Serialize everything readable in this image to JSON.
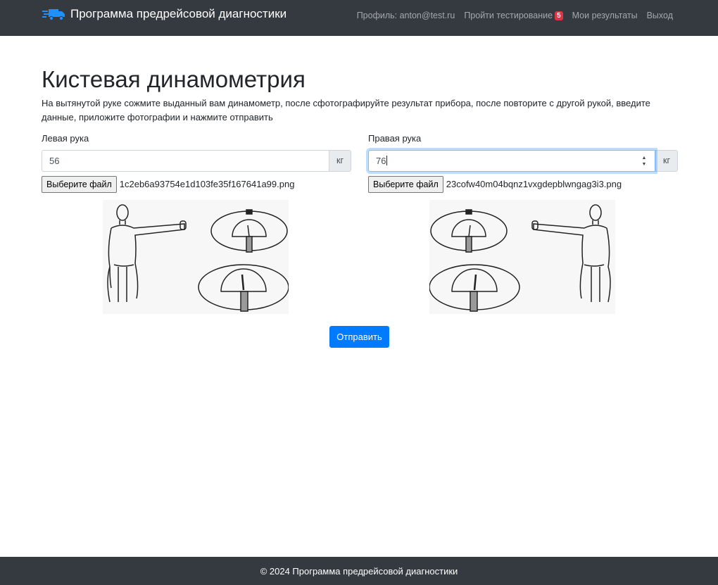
{
  "navbar": {
    "brand": "Программа предрейсовой диагностики",
    "brand_icon": "shipping-fast-truck-icon",
    "profile": "Профиль: anton@test.ru",
    "testing": "Пройти тестирование",
    "testing_badge": "5",
    "results": "Мои результаты",
    "logout": "Выход"
  },
  "page": {
    "title": "Кистевая динамометрия",
    "instructions": "На вытянутой руке сожмите выданный вам динамометр, после сфотографируйте результат прибора, после повторите с другой рукой, введите данные, приложите фотографии и нажмите отправить"
  },
  "left": {
    "label": "Левая рука",
    "value": "56",
    "unit": "кг",
    "file_button": "Выберите файл",
    "file_name": "1c2eb6a93754e1d103fe35f167641a99.png"
  },
  "right": {
    "label": "Правая рука",
    "value": "76",
    "unit": "кг",
    "file_button": "Выберите файл",
    "file_name": "23cofw40m04bqnz1vxgdepblwngag3i3.png"
  },
  "submit": {
    "label": "Отправить"
  },
  "footer": {
    "text": "© 2024 Программа предрейсовой диагностики"
  },
  "colors": {
    "navbar": "#343a40",
    "primary": "#007bff",
    "badge": "#dc3545"
  }
}
